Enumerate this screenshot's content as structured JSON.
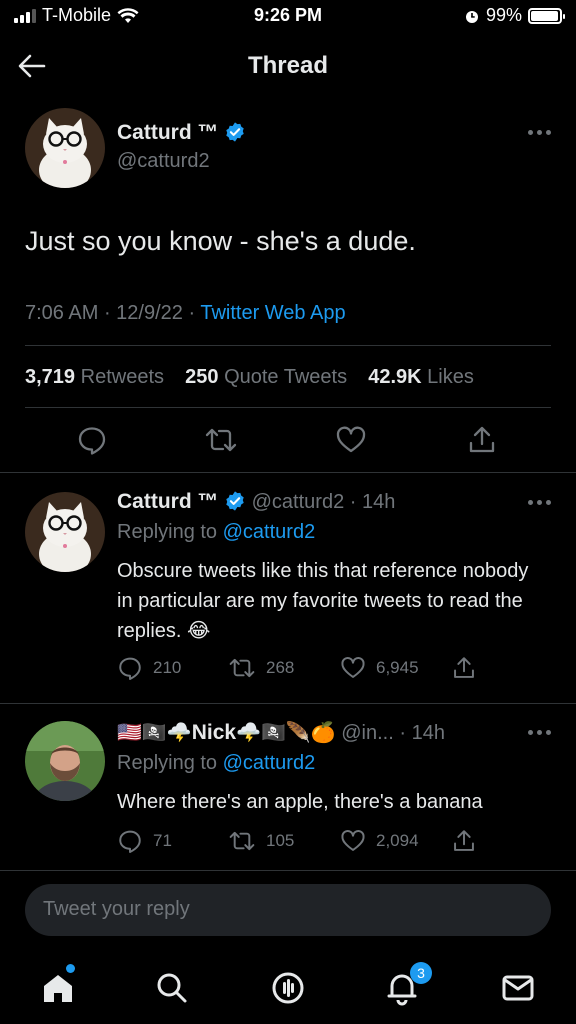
{
  "status_bar": {
    "carrier": "T-Mobile",
    "time": "9:26 PM",
    "battery": "99%"
  },
  "header": {
    "title": "Thread"
  },
  "main_tweet": {
    "name": "Catturd ™",
    "handle": "@catturd2",
    "text": "Just so you know - she's a dude.",
    "time": "7:06 AM",
    "date": "12/9/22",
    "source": "Twitter Web App",
    "retweets": "3,719",
    "retweets_label": "Retweets",
    "quotes": "250",
    "quotes_label": "Quote Tweets",
    "likes": "42.9K",
    "likes_label": "Likes"
  },
  "replies": [
    {
      "name": "Catturd ™",
      "handle": "@catturd2",
      "age": "14h",
      "replying_prefix": "Replying to",
      "replying_to": "@catturd2",
      "text": "Obscure tweets like this that reference nobody in particular are my favorite tweets to read the replies.",
      "emoji": "😂",
      "replies": "210",
      "retweets": "268",
      "likes": "6,945"
    },
    {
      "name_prefix": "🇺🇸🏴‍☠️🌩️",
      "name": "Nick",
      "name_suffix": "🌩️🏴‍☠️🪶🍊",
      "handle": "@in...",
      "age": "14h",
      "replying_prefix": "Replying to",
      "replying_to": "@catturd2",
      "text": "Where there's an apple, there's a banana",
      "replies": "71",
      "retweets": "105",
      "likes": "2,094"
    }
  ],
  "compose": {
    "placeholder": "Tweet your reply"
  },
  "tabbar": {
    "notifications_badge": "3"
  },
  "colors": {
    "accent": "#1d9bf0",
    "background": "#000000",
    "muted": "#71767b",
    "divider": "#2f3336"
  }
}
